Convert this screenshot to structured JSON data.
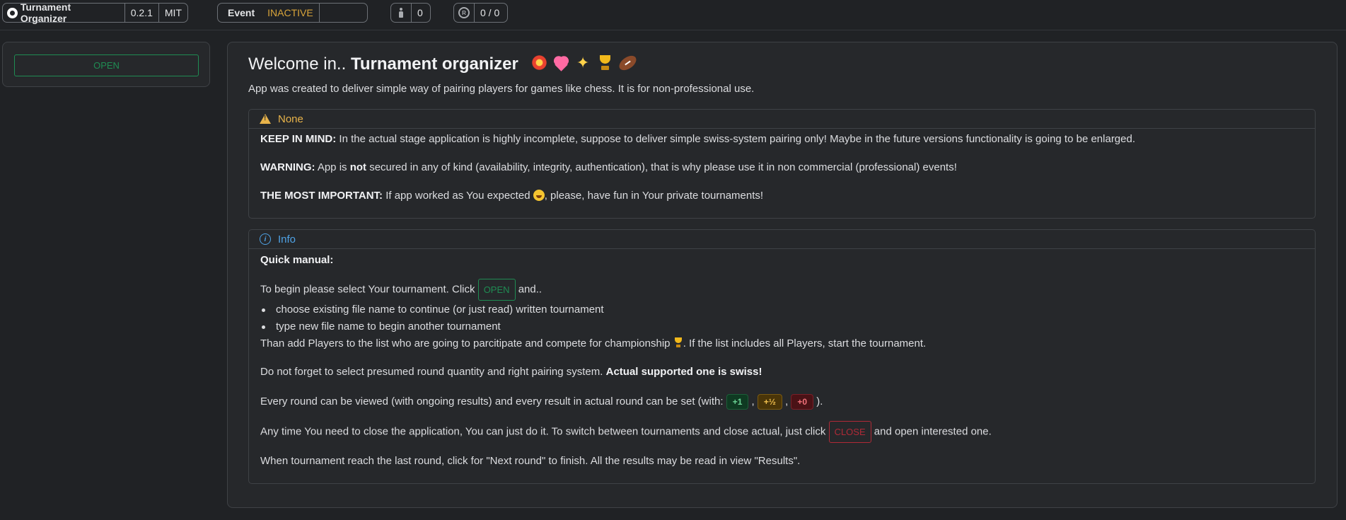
{
  "topbar": {
    "app_name": "Turnament Organizer",
    "version": "0.2.1",
    "license": "MIT",
    "event_label": "Event",
    "event_status": "INACTIVE",
    "players_count": "0",
    "rounds": "0 / 0"
  },
  "sidebar": {
    "open_label": "OPEN"
  },
  "main": {
    "title_prefix": "Welcome in..",
    "title_bold": "Turnament organizer",
    "intro": "App was created to deliver simple way of pairing players for games like chess. It is for non-professional use.",
    "warning_card": {
      "header": "None",
      "keep_label": "KEEP IN MIND:",
      "keep_text": " In the actual stage application is highly incomplete, suppose to deliver simple swiss-system pairing only! Maybe in the future versions functionality is going to be enlarged.",
      "warn_label": "WARNING:",
      "warn_text_a": " App is ",
      "warn_not": "not",
      "warn_text_b": " secured in any of kind (availability, integrity, authentication), that is why please use it in non commercial (professional) events!",
      "important_label": "THE MOST IMPORTANT:",
      "important_text_a": " If app worked as You expected ",
      "important_text_b": ", please, have fun in Your private tournaments!"
    },
    "info_card": {
      "header": "Info",
      "manual_title": "Quick manual:",
      "begin_text": "To begin please select Your tournament. Click ",
      "open_label": "OPEN",
      "begin_tail": " and..",
      "bullets": [
        "choose existing file name to continue (or just read) written tournament",
        "type new file name to begin another tournament"
      ],
      "players_text": "Than add Players to the list who are going to parcitipate and compete for championship ",
      "players_tail": ". If the list includes all Players, start the tournament.",
      "rounds_text": "Do not forget to select presumed round quantity and right pairing system. ",
      "rounds_bold": "Actual supported one is swiss!",
      "results_text": "Every round can be viewed (with ongoing results) and every result in actual round can be set (with: ",
      "badge_win": "+1",
      "badge_draw": "+½",
      "badge_loss": "+0",
      "sep": " , ",
      "results_tail": " ).",
      "close_text": "Any time You need to close the application, You can just do it. To switch between tournaments and close actual, just click ",
      "close_label": "CLOSE",
      "close_tail": " and open interested one.",
      "finish_text": "When tournament reach the last round, click for \"Next round\" to finish. All the results may be read in view \"Results\"."
    }
  },
  "colors": {
    "accent_green": "#1f8c53",
    "warning_yellow": "#e8b34a",
    "info_blue": "#4fa3e6",
    "danger_red": "#b02a37"
  }
}
